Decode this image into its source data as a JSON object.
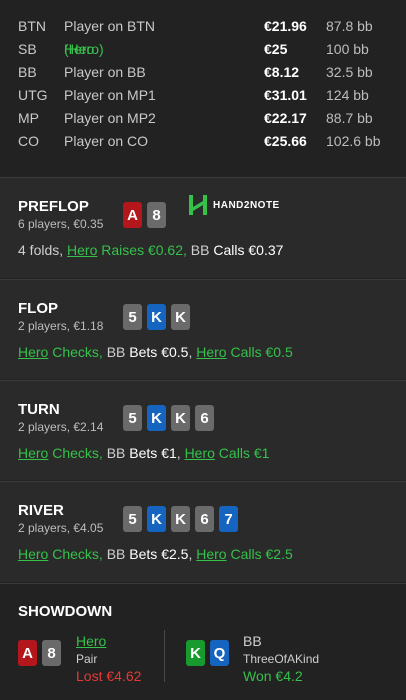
{
  "players": [
    {
      "pos": "BTN",
      "name": "Player on BTN",
      "stack": "€21.96",
      "bb": "87.8 bb",
      "hero": false
    },
    {
      "pos": "SB",
      "name": "Hero",
      "name_extra": " (Hero)",
      "stack": "€25",
      "bb": "100 bb",
      "hero": true
    },
    {
      "pos": "BB",
      "name": "Player on BB",
      "stack": "€8.12",
      "bb": "32.5 bb",
      "hero": false
    },
    {
      "pos": "UTG",
      "name": "Player on MP1",
      "stack": "€31.01",
      "bb": "124 bb",
      "hero": false
    },
    {
      "pos": "MP",
      "name": "Player on MP2",
      "stack": "€22.17",
      "bb": "88.7 bb",
      "hero": false
    },
    {
      "pos": "CO",
      "name": "Player on CO",
      "stack": "€25.66",
      "bb": "102.6 bb",
      "hero": false
    }
  ],
  "logo_text": "HAND2NOTE",
  "preflop": {
    "title": "PREFLOP",
    "sub": "6 players, €0.35",
    "cards": [
      {
        "rank": "A",
        "color": "red"
      },
      {
        "rank": "8",
        "color": "gray"
      }
    ],
    "a1": "4 folds, ",
    "a2": "Hero",
    "a3": " Raises €0.62, ",
    "a4": "BB ",
    "a5": "Calls €0.37"
  },
  "flop": {
    "title": "FLOP",
    "sub": "2 players, €1.18",
    "cards": [
      {
        "rank": "5",
        "color": "gray"
      },
      {
        "rank": "K",
        "color": "blue"
      },
      {
        "rank": "K",
        "color": "gray"
      }
    ],
    "a1": "Hero",
    "a2": " Checks, ",
    "a3": "BB ",
    "a4": "Bets €0.5",
    "a5": ", ",
    "a6": "Hero",
    "a7": " Calls €0.5"
  },
  "turn": {
    "title": "TURN",
    "sub": "2 players, €2.14",
    "cards": [
      {
        "rank": "5",
        "color": "gray"
      },
      {
        "rank": "K",
        "color": "blue"
      },
      {
        "rank": "K",
        "color": "gray"
      },
      {
        "rank": "6",
        "color": "gray"
      }
    ],
    "a1": "Hero",
    "a2": " Checks, ",
    "a3": "BB ",
    "a4": "Bets €1",
    "a5": ", ",
    "a6": "Hero",
    "a7": " Calls €1"
  },
  "river": {
    "title": "RIVER",
    "sub": "2 players, €4.05",
    "cards": [
      {
        "rank": "5",
        "color": "gray"
      },
      {
        "rank": "K",
        "color": "blue"
      },
      {
        "rank": "K",
        "color": "gray"
      },
      {
        "rank": "6",
        "color": "gray"
      },
      {
        "rank": "7",
        "color": "blue"
      }
    ],
    "a1": "Hero",
    "a2": " Checks, ",
    "a3": "BB ",
    "a4": "Bets €2.5",
    "a5": ", ",
    "a6": "Hero",
    "a7": " Calls €2.5"
  },
  "showdown": {
    "title": "SHOWDOWN",
    "left": {
      "cards": [
        {
          "rank": "A",
          "color": "red"
        },
        {
          "rank": "8",
          "color": "gray"
        }
      ],
      "name": "Hero",
      "hand": "Pair",
      "result": "Lost €4.62"
    },
    "right": {
      "cards": [
        {
          "rank": "K",
          "color": "green"
        },
        {
          "rank": "Q",
          "color": "blue"
        }
      ],
      "name": "BB",
      "hand": "ThreeOfAKind",
      "result": "Won €4.2"
    }
  },
  "colors": {
    "red": "#b3161b",
    "gray": "#6a6a6a",
    "blue": "#1565c0",
    "green": "#179a2e",
    "hero": "#35c14a",
    "lost": "#e53935"
  }
}
